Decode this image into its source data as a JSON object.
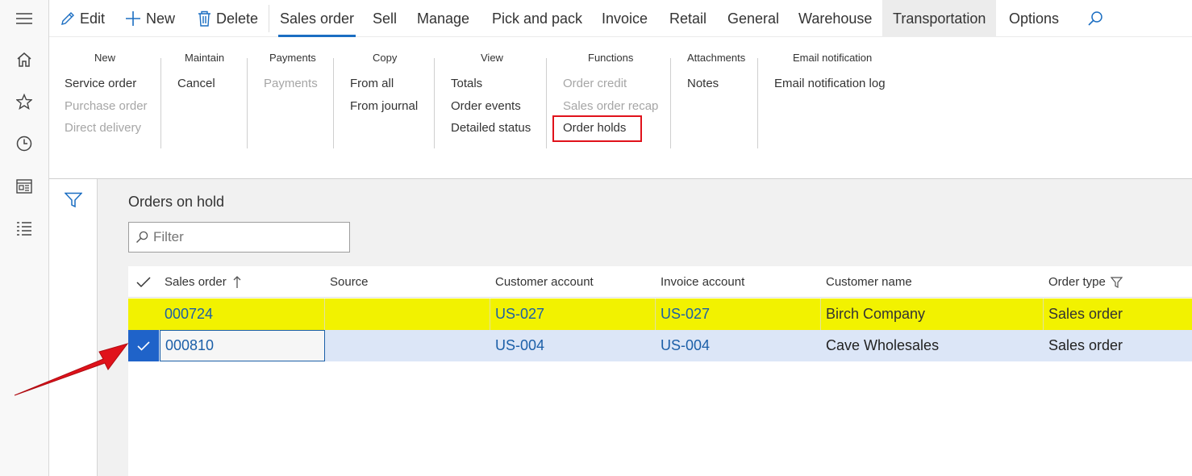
{
  "rail": {
    "icons": [
      "hamburger-icon",
      "home-icon",
      "star-icon",
      "clock-icon",
      "workspace-icon",
      "list-icon"
    ]
  },
  "topbar": {
    "edit": "Edit",
    "new": "New",
    "delete": "Delete",
    "tabs": [
      "Sales order",
      "Sell",
      "Manage",
      "Pick and pack",
      "Invoice",
      "Retail",
      "General",
      "Warehouse",
      "Transportation",
      "Options"
    ],
    "active_tab": "Sales order"
  },
  "ribbon": {
    "groups": [
      {
        "title": "New",
        "items": [
          {
            "label": "Service order"
          },
          {
            "label": "Purchase order",
            "disabled": true
          },
          {
            "label": "Direct delivery",
            "disabled": true
          }
        ]
      },
      {
        "title": "Maintain",
        "items": [
          {
            "label": "Cancel"
          }
        ]
      },
      {
        "title": "Payments",
        "items": [
          {
            "label": "Payments",
            "disabled": true
          }
        ]
      },
      {
        "title": "Copy",
        "items": [
          {
            "label": "From all"
          },
          {
            "label": "From journal"
          }
        ]
      },
      {
        "title": "View",
        "items": [
          {
            "label": "Totals"
          },
          {
            "label": "Order events"
          },
          {
            "label": "Detailed status"
          }
        ]
      },
      {
        "title": "Functions",
        "items": [
          {
            "label": "Order credit",
            "disabled": true
          },
          {
            "label": "Sales order recap",
            "disabled": true
          },
          {
            "label": "Order holds",
            "highlighted": true
          }
        ]
      },
      {
        "title": "Attachments",
        "items": [
          {
            "label": "Notes"
          }
        ]
      },
      {
        "title": "Email notification",
        "items": [
          {
            "label": "Email notification log"
          }
        ]
      }
    ]
  },
  "page": {
    "title": "Orders on hold",
    "filter_placeholder": "Filter"
  },
  "grid": {
    "columns": [
      "Sales order",
      "Source",
      "Customer account",
      "Invoice account",
      "Customer name",
      "Order type"
    ],
    "rows": [
      {
        "sales_order": "000724",
        "source": "",
        "customer_account": "US-027",
        "invoice_account": "US-027",
        "customer_name": "Birch Company",
        "order_type": "Sales order"
      },
      {
        "sales_order": "000810",
        "source": "",
        "customer_account": "US-004",
        "invoice_account": "US-004",
        "customer_name": "Cave Wholesales",
        "order_type": "Sales order"
      }
    ]
  },
  "colors": {
    "accent": "#1b6ec2",
    "highlight_row": "#f2f200",
    "selected_row": "#dce6f7",
    "annotation_red": "#e0121b"
  }
}
